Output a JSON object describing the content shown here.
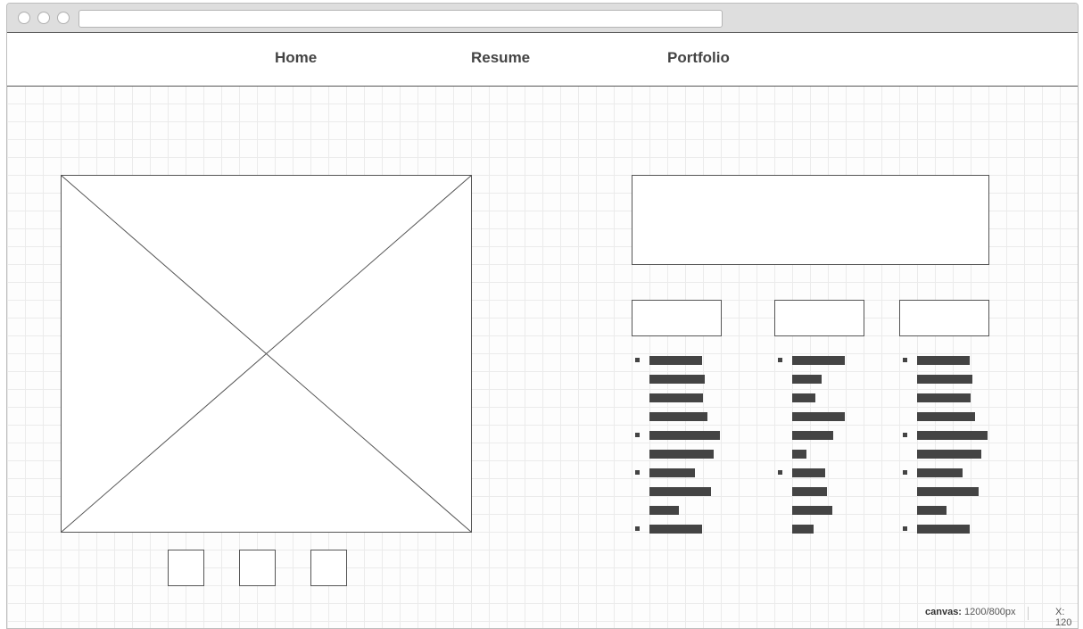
{
  "nav": {
    "items": [
      {
        "label": "Home"
      },
      {
        "label": "Resume"
      },
      {
        "label": "Portfolio"
      }
    ]
  },
  "lists": [
    {
      "items": [
        {
          "lines": [
            59,
            62,
            60,
            65
          ]
        },
        {
          "lines": [
            79,
            72
          ]
        },
        {
          "lines": [
            51,
            69,
            33
          ]
        },
        {
          "lines": [
            59
          ]
        }
      ]
    },
    {
      "items": [
        {
          "lines": [
            59,
            33,
            26,
            59,
            46,
            16
          ]
        },
        {
          "lines": [
            37,
            39,
            45,
            24
          ]
        }
      ]
    },
    {
      "items": [
        {
          "lines": [
            59,
            62,
            60,
            65
          ]
        },
        {
          "lines": [
            79,
            72
          ]
        },
        {
          "lines": [
            51,
            69,
            33
          ]
        },
        {
          "lines": [
            59
          ]
        }
      ]
    }
  ],
  "status": {
    "canvas_label": "canvas:",
    "canvas_value": "1200/800px",
    "x_label": "X:",
    "x_value": "120"
  }
}
